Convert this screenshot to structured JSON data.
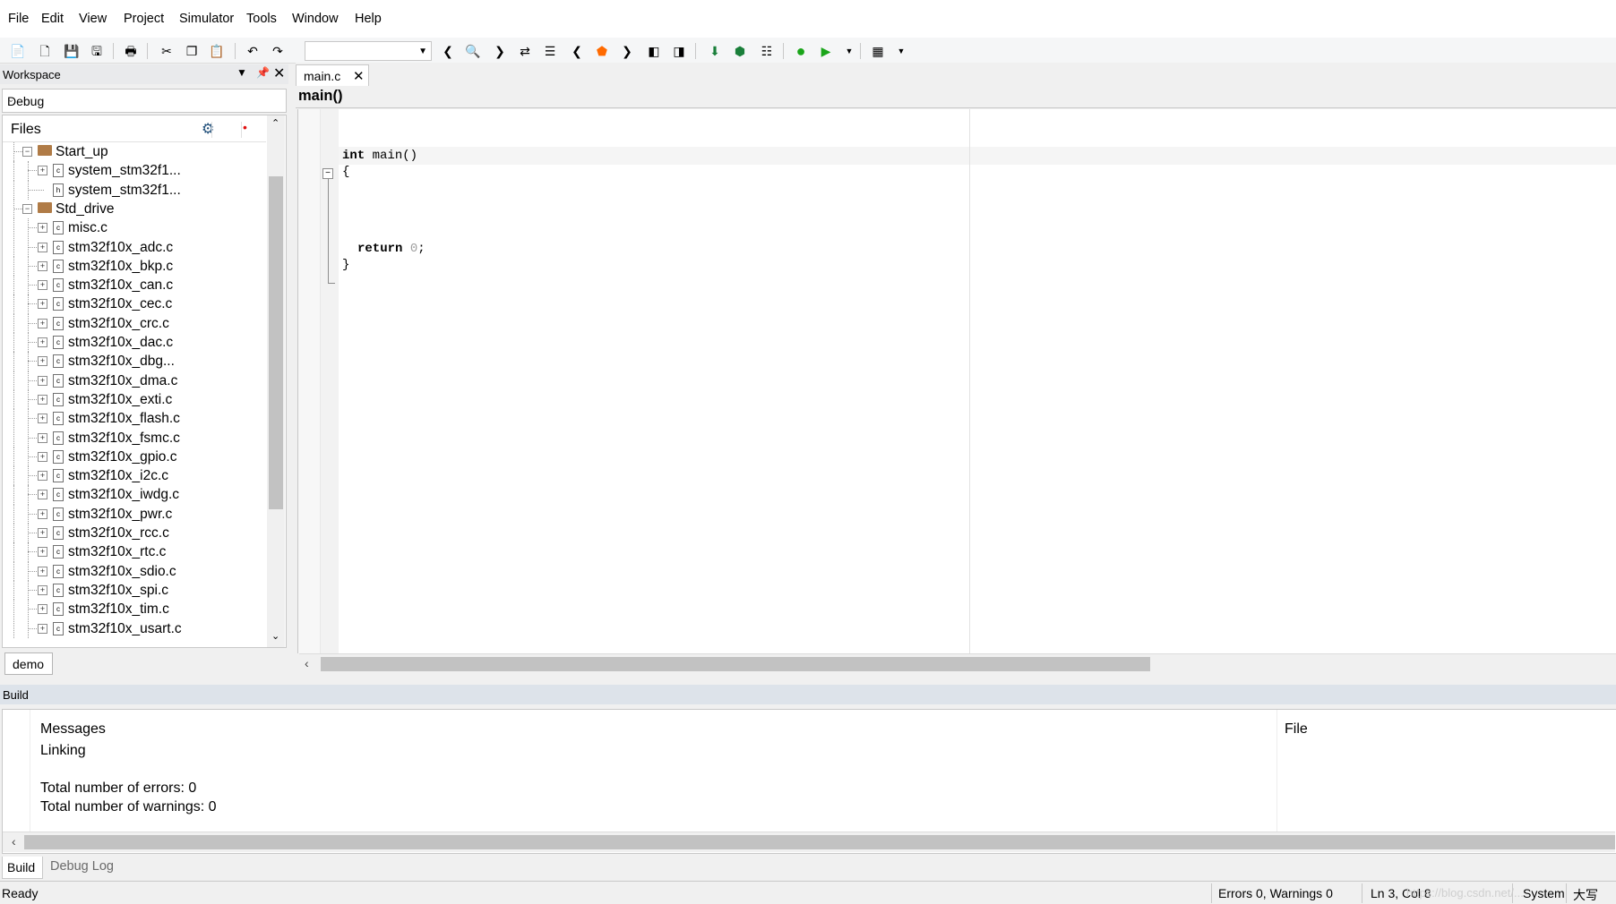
{
  "menu": [
    "File",
    "Edit",
    "View",
    "Project",
    "Simulator",
    "Tools",
    "Window",
    "Help"
  ],
  "toolbar": {
    "icons": [
      "new-file-icon",
      "open-file-icon",
      "save-icon",
      "save-all-icon",
      "print-icon",
      "cut-icon",
      "copy-icon",
      "paste-icon",
      "undo-icon",
      "redo-icon",
      "find-back-icon",
      "find-icon",
      "find-forward-icon",
      "toggle-bookmark-icon",
      "next-bookmark-icon",
      "prev-icon",
      "breakpoint-icon",
      "next-icon",
      "prev-error-icon",
      "next-error-icon",
      "download-debug-icon",
      "download-icon",
      "options-icon",
      "make-icon",
      "compile-icon",
      "toolbar-overflow-icon",
      "custom-tool-icon"
    ],
    "search_value": ""
  },
  "workspace": {
    "title": "Workspace",
    "config": "Debug",
    "tree_header": "Files",
    "tab": "demo",
    "tree": [
      {
        "label": "Start_up",
        "type": "folder",
        "level": 0,
        "expander": "minus"
      },
      {
        "label": "system_stm32f1...",
        "type": "c",
        "level": 1,
        "expander": "plus"
      },
      {
        "label": "system_stm32f1...",
        "type": "h",
        "level": 1,
        "expander": "none"
      },
      {
        "label": "Std_drive",
        "type": "folder",
        "level": 0,
        "expander": "minus"
      },
      {
        "label": "misc.c",
        "type": "c",
        "level": 1,
        "expander": "plus"
      },
      {
        "label": "stm32f10x_adc.c",
        "type": "c",
        "level": 1,
        "expander": "plus"
      },
      {
        "label": "stm32f10x_bkp.c",
        "type": "c",
        "level": 1,
        "expander": "plus"
      },
      {
        "label": "stm32f10x_can.c",
        "type": "c",
        "level": 1,
        "expander": "plus"
      },
      {
        "label": "stm32f10x_cec.c",
        "type": "c",
        "level": 1,
        "expander": "plus"
      },
      {
        "label": "stm32f10x_crc.c",
        "type": "c",
        "level": 1,
        "expander": "plus"
      },
      {
        "label": "stm32f10x_dac.c",
        "type": "c",
        "level": 1,
        "expander": "plus"
      },
      {
        "label": "stm32f10x_dbg...",
        "type": "c",
        "level": 1,
        "expander": "plus"
      },
      {
        "label": "stm32f10x_dma.c",
        "type": "c",
        "level": 1,
        "expander": "plus"
      },
      {
        "label": "stm32f10x_exti.c",
        "type": "c",
        "level": 1,
        "expander": "plus"
      },
      {
        "label": "stm32f10x_flash.c",
        "type": "c",
        "level": 1,
        "expander": "plus"
      },
      {
        "label": "stm32f10x_fsmc.c",
        "type": "c",
        "level": 1,
        "expander": "plus"
      },
      {
        "label": "stm32f10x_gpio.c",
        "type": "c",
        "level": 1,
        "expander": "plus"
      },
      {
        "label": "stm32f10x_i2c.c",
        "type": "c",
        "level": 1,
        "expander": "plus"
      },
      {
        "label": "stm32f10x_iwdg.c",
        "type": "c",
        "level": 1,
        "expander": "plus"
      },
      {
        "label": "stm32f10x_pwr.c",
        "type": "c",
        "level": 1,
        "expander": "plus"
      },
      {
        "label": "stm32f10x_rcc.c",
        "type": "c",
        "level": 1,
        "expander": "plus"
      },
      {
        "label": "stm32f10x_rtc.c",
        "type": "c",
        "level": 1,
        "expander": "plus"
      },
      {
        "label": "stm32f10x_sdio.c",
        "type": "c",
        "level": 1,
        "expander": "plus"
      },
      {
        "label": "stm32f10x_spi.c",
        "type": "c",
        "level": 1,
        "expander": "plus"
      },
      {
        "label": "stm32f10x_tim.c",
        "type": "c",
        "level": 1,
        "expander": "plus"
      },
      {
        "label": "stm32f10x_usart.c",
        "type": "c",
        "level": 1,
        "expander": "plus"
      }
    ]
  },
  "editor": {
    "tab": "main.c",
    "function": "main()",
    "code": {
      "l1_type": "int",
      "l1_rest": " main()",
      "open_brace": "{",
      "ret_kw": "return",
      "ret_val": "0",
      "ret_end": ";",
      "close_brace": "}"
    }
  },
  "build": {
    "title": "Build",
    "col_messages": "Messages",
    "col_file": "File",
    "lines": [
      "Linking",
      "",
      "Total number of errors: 0",
      "Total number of warnings: 0"
    ],
    "tabs": [
      "Build",
      "Debug Log"
    ]
  },
  "status": {
    "left": "Ready",
    "errors": "Errors 0, Warnings 0",
    "position": "Ln 3, Col 8",
    "system": "System",
    "ime": "大写",
    "watermark": "https://blog.csdn.net/..."
  },
  "colors": {
    "run_green": "#1aa51a",
    "breakpoint_orange": "#ff6a00",
    "download_green": "#1a7f3a",
    "status_red": "#e01010",
    "folder_brown": "#b07b46"
  }
}
